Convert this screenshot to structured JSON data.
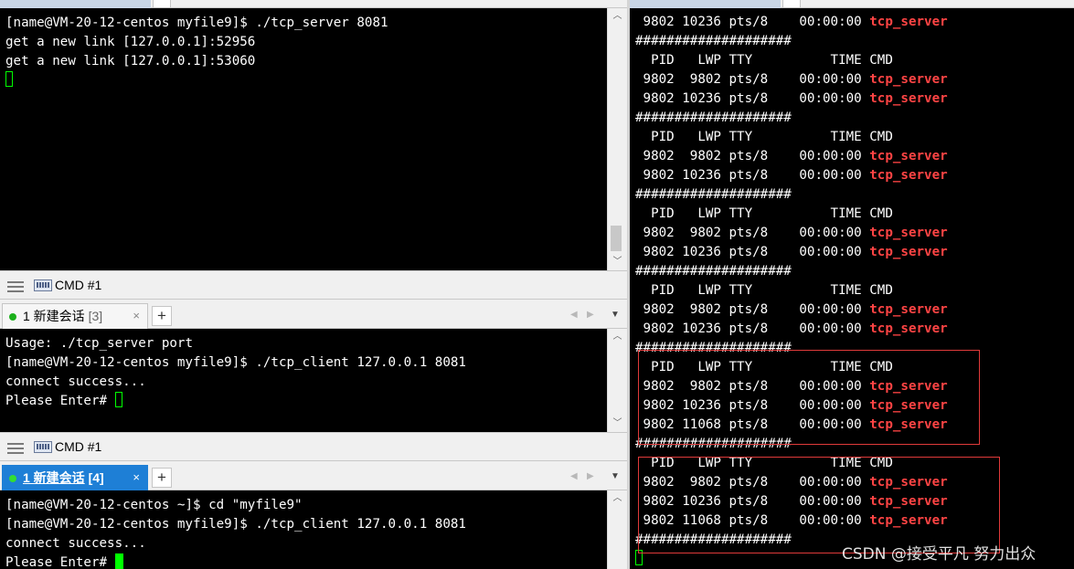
{
  "pane_top": {
    "lines": [
      "[name@VM-20-12-centos myfile9]$ ./tcp_server 8081",
      "get a new link [127.0.0.1]:52956",
      "get a new link [127.0.0.1]:53060"
    ]
  },
  "statusbar_1": {
    "label": "CMD #1"
  },
  "tabbar_2": {
    "tab_label": "1 新建会话",
    "tab_count": "[3]",
    "close": "×",
    "plus": "+",
    "nav_left": "◀",
    "nav_right": "▶",
    "menu": "▼"
  },
  "pane_mid": {
    "lines": [
      "Usage: ./tcp_server port",
      "[name@VM-20-12-centos myfile9]$ ./tcp_client 127.0.0.1 8081",
      "connect success...",
      "Please Enter# "
    ]
  },
  "statusbar_2": {
    "label": "CMD #1"
  },
  "tabbar_3": {
    "tab_label": "1 新建会话",
    "tab_count": "[4]",
    "close": "×",
    "plus": "+",
    "nav_left": "◀",
    "nav_right": "▶",
    "menu": "▼"
  },
  "pane_bottom": {
    "lines": [
      "[name@VM-20-12-centos ~]$ cd \"myfile9\"",
      "[name@VM-20-12-centos myfile9]$ ./tcp_client 127.0.0.1 8081",
      "connect success...",
      "Please Enter# "
    ]
  },
  "pane_right": {
    "lines": [
      {
        "t": " 9802 10236 pts/8    00:00:00 ",
        "r": "tcp_server"
      },
      {
        "t": "####################",
        "r": ""
      },
      {
        "t": "  PID   LWP TTY          TIME CMD",
        "r": ""
      },
      {
        "t": " 9802  9802 pts/8    00:00:00 ",
        "r": "tcp_server"
      },
      {
        "t": " 9802 10236 pts/8    00:00:00 ",
        "r": "tcp_server"
      },
      {
        "t": "####################",
        "r": ""
      },
      {
        "t": "  PID   LWP TTY          TIME CMD",
        "r": ""
      },
      {
        "t": " 9802  9802 pts/8    00:00:00 ",
        "r": "tcp_server"
      },
      {
        "t": " 9802 10236 pts/8    00:00:00 ",
        "r": "tcp_server"
      },
      {
        "t": "####################",
        "r": ""
      },
      {
        "t": "  PID   LWP TTY          TIME CMD",
        "r": ""
      },
      {
        "t": " 9802  9802 pts/8    00:00:00 ",
        "r": "tcp_server"
      },
      {
        "t": " 9802 10236 pts/8    00:00:00 ",
        "r": "tcp_server"
      },
      {
        "t": "####################",
        "r": ""
      },
      {
        "t": "  PID   LWP TTY          TIME CMD",
        "r": ""
      },
      {
        "t": " 9802  9802 pts/8    00:00:00 ",
        "r": "tcp_server"
      },
      {
        "t": " 9802 10236 pts/8    00:00:00 ",
        "r": "tcp_server"
      },
      {
        "t": "####################",
        "r": ""
      },
      {
        "t": "  PID   LWP TTY          TIME CMD",
        "r": ""
      },
      {
        "t": " 9802  9802 pts/8    00:00:00 ",
        "r": "tcp_server"
      },
      {
        "t": " 9802 10236 pts/8    00:00:00 ",
        "r": "tcp_server"
      },
      {
        "t": " 9802 11068 pts/8    00:00:00 ",
        "r": "tcp_server"
      },
      {
        "t": "####################",
        "r": ""
      },
      {
        "t": "  PID   LWP TTY          TIME CMD",
        "r": ""
      },
      {
        "t": " 9802  9802 pts/8    00:00:00 ",
        "r": "tcp_server"
      },
      {
        "t": " 9802 10236 pts/8    00:00:00 ",
        "r": "tcp_server"
      },
      {
        "t": " 9802 11068 pts/8    00:00:00 ",
        "r": "tcp_server"
      },
      {
        "t": "####################",
        "r": ""
      }
    ]
  },
  "watermark": "CSDN @接受平凡 努力出众",
  "colors": {
    "terminal_bg": "#000000",
    "terminal_fg": "#ffffff",
    "cursor": "#00ff00",
    "process_name": "#ff4444",
    "highlight_box": "#e03a3a",
    "active_tab_bg": "#1e7fd6"
  }
}
